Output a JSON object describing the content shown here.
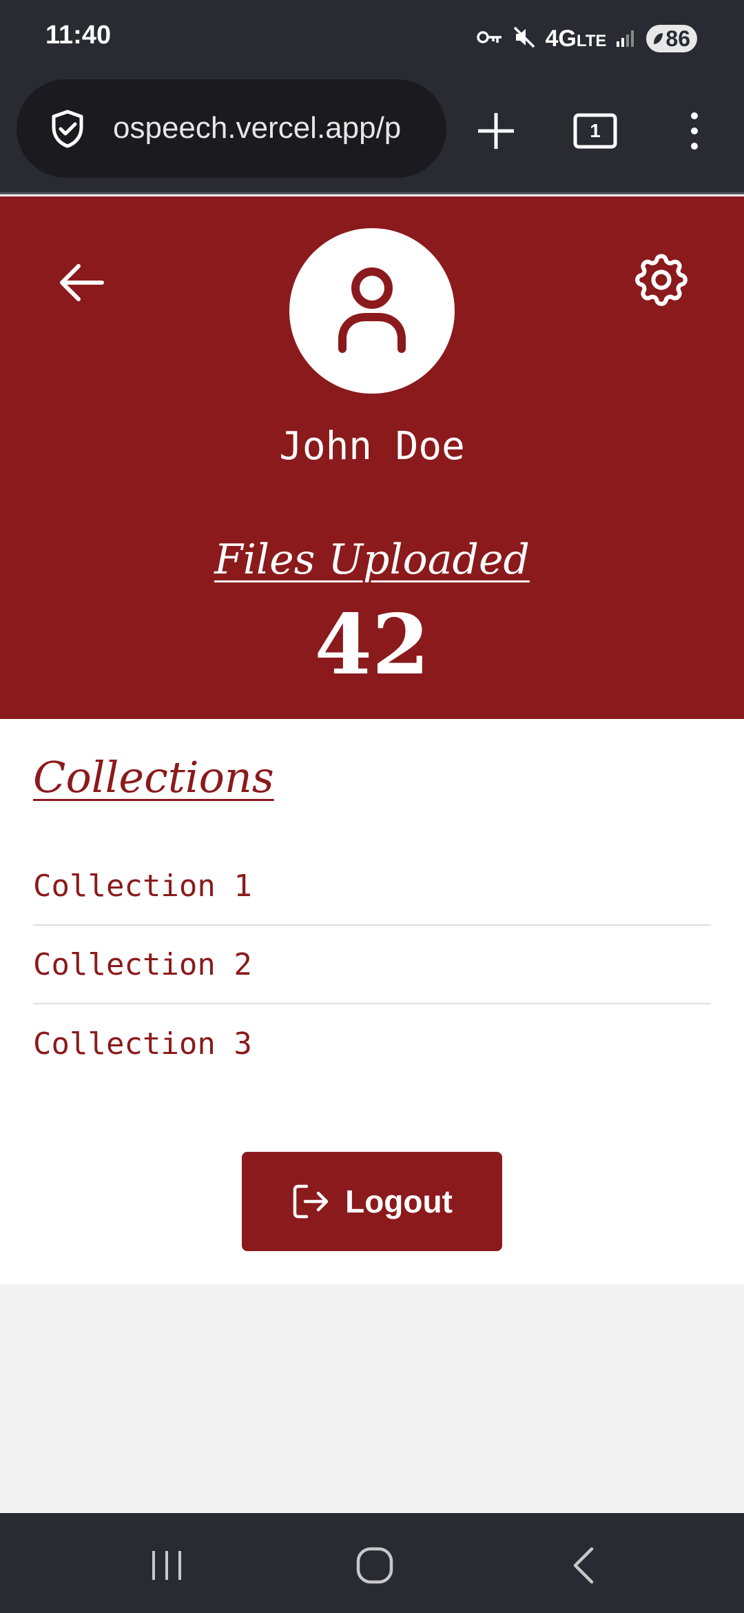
{
  "status_bar": {
    "time": "11:40",
    "network": "4G",
    "network_suffix": "LTE",
    "battery": "86"
  },
  "browser": {
    "url": "ospeech.vercel.app/p",
    "tab_count": "1"
  },
  "profile": {
    "name": "John Doe",
    "files_label": "Files Uploaded",
    "files_count": "42"
  },
  "collections": {
    "title": "Collections",
    "items": [
      {
        "label": "Collection 1"
      },
      {
        "label": "Collection 2"
      },
      {
        "label": "Collection 3"
      }
    ]
  },
  "actions": {
    "logout_label": "Logout"
  },
  "colors": {
    "brand": "#8b1a1c",
    "system_bar": "#2a2a33",
    "page_background": "#f3f3f3"
  },
  "icons": {
    "header_left": "arrow-left-icon",
    "header_right": "gear-icon",
    "avatar": "user-icon",
    "logout": "logout-icon"
  }
}
